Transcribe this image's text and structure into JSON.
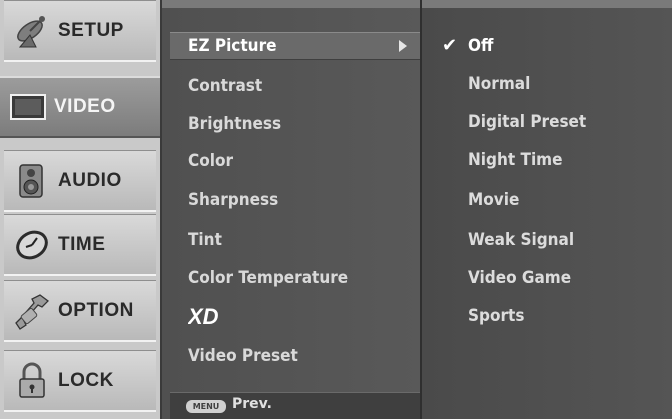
{
  "categories": [
    {
      "label": "SETUP",
      "icon": "satellite-dish-icon"
    },
    {
      "label": "VIDEO",
      "icon": "tv-screen-icon",
      "active": true
    },
    {
      "label": "AUDIO",
      "icon": "speaker-icon"
    },
    {
      "label": "TIME",
      "icon": "clock-icon"
    },
    {
      "label": "OPTION",
      "icon": "wrench-icon"
    },
    {
      "label": "LOCK",
      "icon": "padlock-icon"
    }
  ],
  "items": [
    {
      "label": "EZ Picture",
      "active": true
    },
    {
      "label": "Contrast"
    },
    {
      "label": "Brightness"
    },
    {
      "label": "Color"
    },
    {
      "label": "Sharpness"
    },
    {
      "label": "Tint"
    },
    {
      "label": "Color Temperature"
    },
    {
      "label": "XD",
      "logo": true
    },
    {
      "label": "Video Preset"
    }
  ],
  "footer": {
    "key_label": "MENU",
    "prev_label": "Prev."
  },
  "options": [
    {
      "label": "Off",
      "selected": true
    },
    {
      "label": "Normal"
    },
    {
      "label": "Digital Preset"
    },
    {
      "label": "Night Time"
    },
    {
      "label": "Movie"
    },
    {
      "label": "Weak Signal"
    },
    {
      "label": "Video Game"
    },
    {
      "label": "Sports"
    }
  ],
  "colors": {
    "background": "#9b9b9b",
    "category_bg": "#c9c9c9",
    "panel_bg": "#555555",
    "text": "#dcdcdc"
  }
}
